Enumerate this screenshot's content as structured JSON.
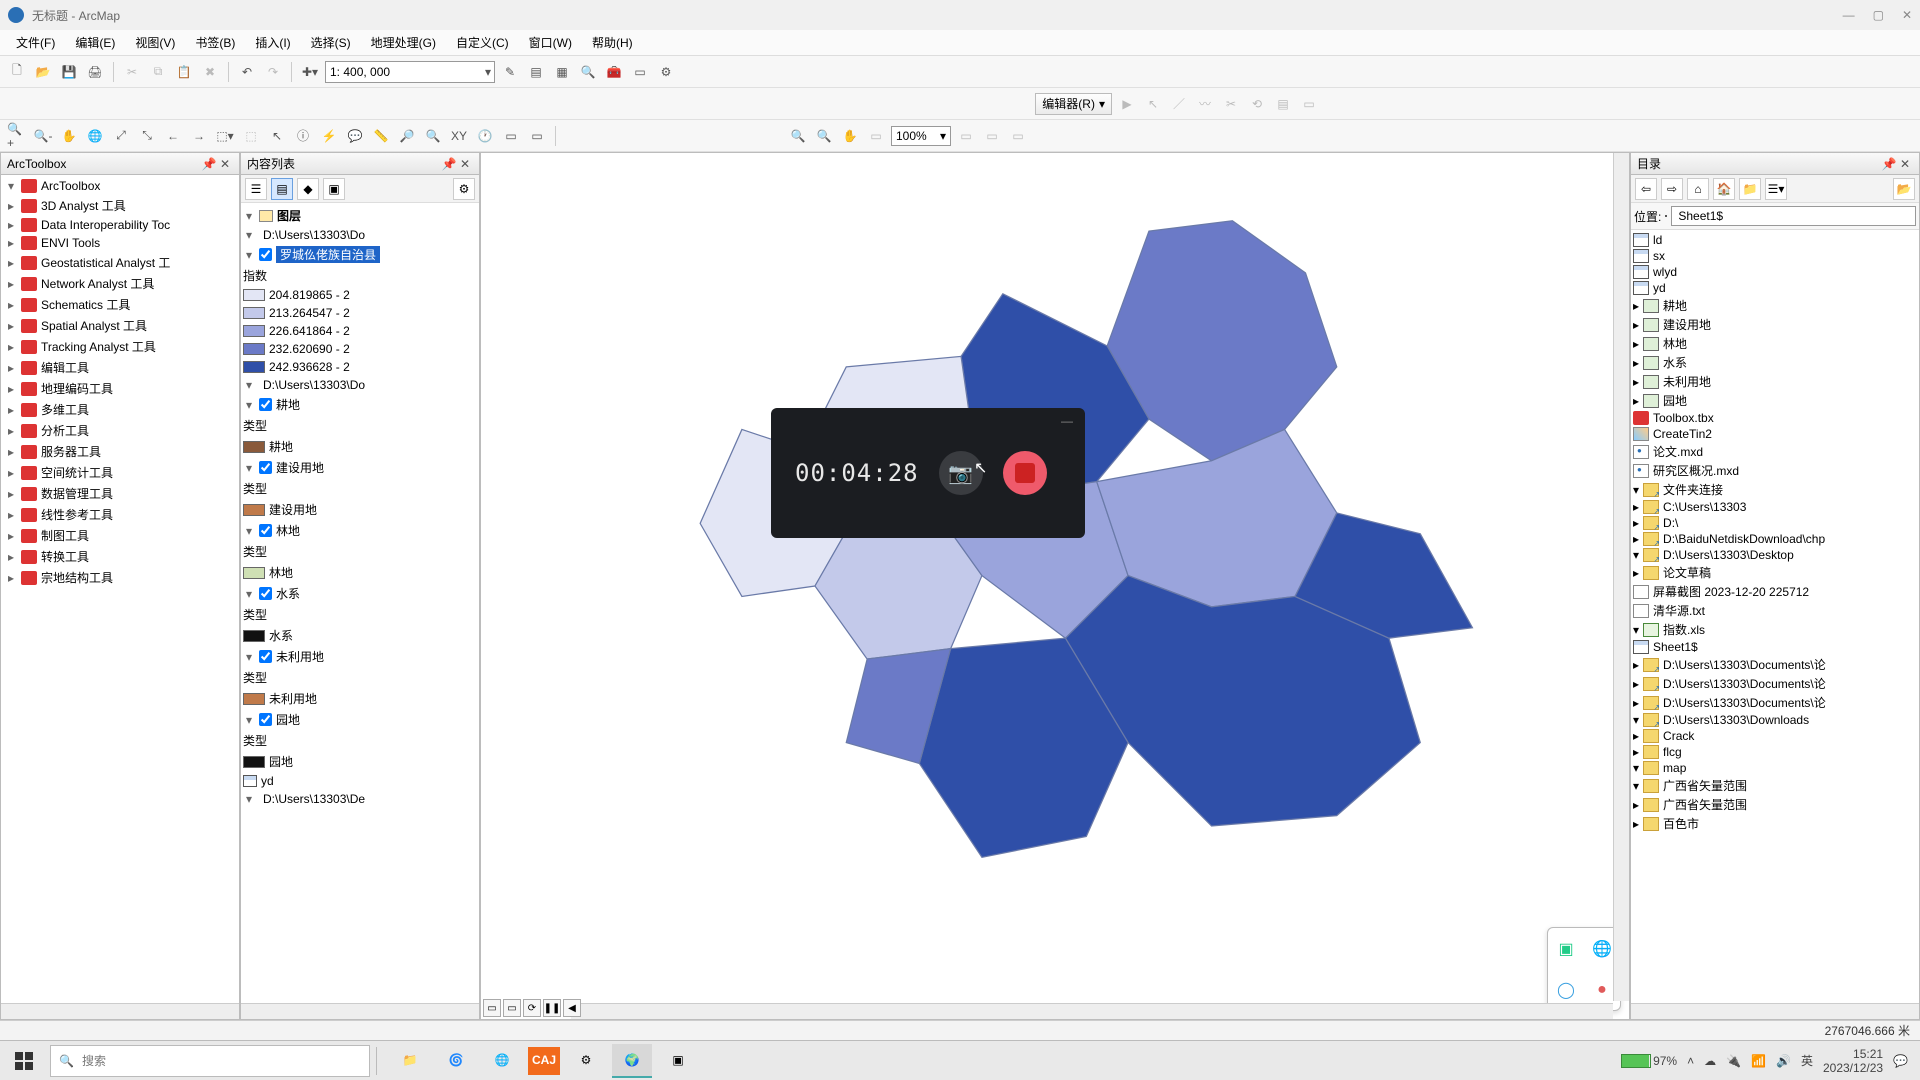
{
  "window": {
    "title": "无标题 - ArcMap"
  },
  "menu": [
    "文件(F)",
    "编辑(E)",
    "视图(V)",
    "书签(B)",
    "插入(I)",
    "选择(S)",
    "地理处理(G)",
    "自定义(C)",
    "窗口(W)",
    "帮助(H)"
  ],
  "scale": "1: 400, 000",
  "editor_label": "编辑器(R)",
  "zoom_pct": "100%",
  "panels": {
    "arctoolbox": {
      "title": "ArcToolbox",
      "root": "ArcToolbox",
      "items": [
        "3D Analyst 工具",
        "Data Interoperability Toc",
        "ENVI Tools",
        "Geostatistical Analyst 工",
        "Network Analyst 工具",
        "Schematics 工具",
        "Spatial Analyst 工具",
        "Tracking Analyst 工具",
        "编辑工具",
        "地理编码工具",
        "多维工具",
        "分析工具",
        "服务器工具",
        "空间统计工具",
        "数据管理工具",
        "线性参考工具",
        "制图工具",
        "转换工具",
        "宗地结构工具"
      ]
    },
    "toc": {
      "title": "内容列表",
      "layers_group": "图层",
      "data_frame1": "D:\\Users\\13303\\Do",
      "selected_layer": "罗城仫佬族自治县",
      "index_label": "指数",
      "class_breaks": [
        {
          "label": "204.819865 - 2",
          "color": "#e3e6f5"
        },
        {
          "label": "213.264547 - 2",
          "color": "#c3c9ea"
        },
        {
          "label": "226.641864 - 2",
          "color": "#9aa4dc"
        },
        {
          "label": "232.620690 - 2",
          "color": "#6b7ac7"
        },
        {
          "label": "242.936628 - 2",
          "color": "#2f4fa8"
        }
      ],
      "data_frame2": "D:\\Users\\13303\\Do",
      "groups": [
        {
          "name": "耕地",
          "type_label": "类型",
          "sym": "#8a5a3b"
        },
        {
          "name": "建设用地",
          "type_label": "类型",
          "sym": "#c07a4a"
        },
        {
          "name": "林地",
          "type_label": "类型",
          "sym": "#cfe0b4"
        },
        {
          "name": "水系",
          "type_label": "类型",
          "sym": "#111111"
        },
        {
          "name": "未利用地",
          "type_label": "类型",
          "sym": "#c07a4a"
        },
        {
          "name": "园地",
          "type_label": "类型",
          "sym": "#111111"
        }
      ],
      "yd_table": "yd",
      "data_frame3": "D:\\Users\\13303\\De"
    },
    "catalog": {
      "title": "目录",
      "location_label": "位置:",
      "location_value": "Sheet1$",
      "tables": [
        "ld",
        "sx",
        "wlyd",
        "yd"
      ],
      "fc_layers": [
        "耕地",
        "建设用地",
        "林地",
        "水系",
        "未利用地",
        "园地"
      ],
      "toolbox_file": "Toolbox.tbx",
      "tin": "CreateTin2",
      "mxd1": "论文.mxd",
      "mxd2": "研究区概况.mxd",
      "folder_conn": "文件夹连接",
      "dirs": [
        "C:\\Users\\13303",
        "D:\\",
        "D:\\BaiduNetdiskDownload\\chp",
        "D:\\Users\\13303\\Desktop"
      ],
      "desktop_children": {
        "folder1": "论文草稿",
        "png": "屏幕截图 2023-12-20 225712",
        "txt": "清华源.txt",
        "xls": "指数.xls",
        "sheet": "Sheet1$"
      },
      "doc_dirs": [
        "D:\\Users\\13303\\Documents\\论",
        "D:\\Users\\13303\\Documents\\论",
        "D:\\Users\\13303\\Documents\\论"
      ],
      "downloads": "D:\\Users\\13303\\Downloads",
      "dl_children": {
        "crack": "Crack",
        "flcg": "flcg",
        "map": "map",
        "gx1": "广西省矢量范围",
        "gx2": "广西省矢量范围",
        "baise": "百色市"
      }
    }
  },
  "recorder": {
    "time": "00:04:28"
  },
  "status": {
    "coords": "2767046.666 米"
  },
  "taskbar": {
    "search_placeholder": "搜索",
    "battery_pct": "97%",
    "ime": "英",
    "time": "15:21",
    "date": "2023/12/23"
  },
  "map_colors": {
    "c1": "#e3e6f5",
    "c2": "#c3c9ea",
    "c3": "#9aa4dc",
    "c4": "#6b7ac7",
    "c5": "#2f4fa8",
    "stroke": "#6a7aa8"
  }
}
